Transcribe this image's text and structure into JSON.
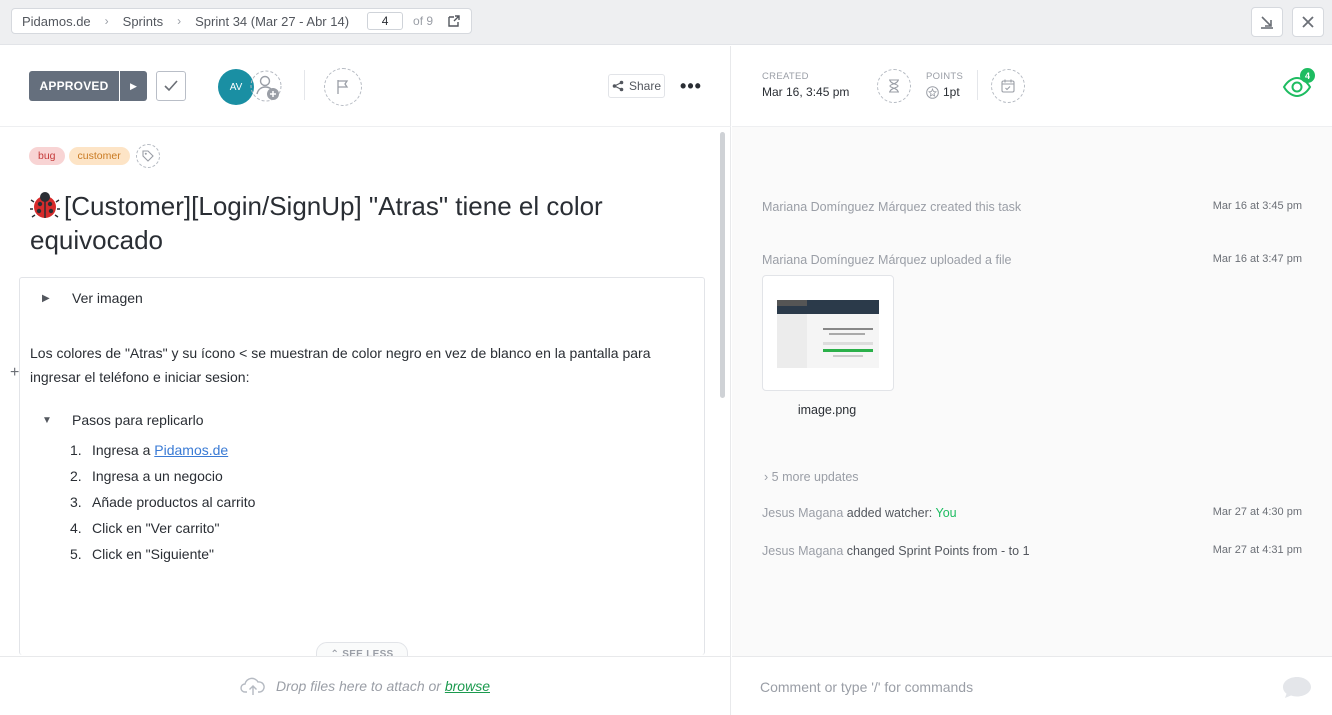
{
  "breadcrumb": {
    "items": [
      "Pidamos.de",
      "Sprints",
      "Sprint 34 (Mar 27 - Abr 14)"
    ],
    "page": "4",
    "of": "of 9"
  },
  "toolbar": {
    "status": "APPROVED",
    "avatar_initials": "AV",
    "share_label": "Share",
    "more": "•••"
  },
  "tags": [
    "bug",
    "customer"
  ],
  "task": {
    "title": "[Customer][Login/SignUp] \"Atras\" tiene el color equivocado",
    "toggle1": "Ver imagen",
    "description": "Los colores de \"Atras\" y su ícono < se muestran de color negro en vez de blanco en la pantalla para ingresar el teléfono e iniciar sesion:",
    "toggle2": "Pasos para replicarlo",
    "steps": [
      {
        "num": "1.",
        "prefix": "Ingresa a ",
        "link": "Pidamos.de"
      },
      {
        "num": "2.",
        "text": "Ingresa a un negocio"
      },
      {
        "num": "3.",
        "text": "Añade productos al carrito"
      },
      {
        "num": "4.",
        "text": "Click en \"Ver carrito\""
      },
      {
        "num": "5.",
        "text": "Click en \"Siguiente\""
      }
    ],
    "see_less": "SEE LESS"
  },
  "meta": {
    "created_label": "CREATED",
    "created_value": "Mar 16, 3:45 pm",
    "points_label": "POINTS",
    "points_value": "1pt",
    "watchers": "4"
  },
  "activity": [
    {
      "text": "Mariana Domínguez Márquez created this task",
      "time": "Mar 16 at 3:45 pm"
    },
    {
      "text": "Mariana Domínguez Márquez uploaded a file",
      "time": "Mar 16 at 3:47 pm"
    },
    {
      "actor": "Jesus Magana",
      "action": "added watcher: ",
      "target": "You",
      "time": "Mar 27 at 4:30 pm"
    },
    {
      "actor": "Jesus Magana",
      "action": "changed Sprint Points from - to 1",
      "time": "Mar 27 at 4:31 pm"
    }
  ],
  "file": {
    "name": "image.png"
  },
  "more_updates": "5 more updates",
  "attach": {
    "text": "Drop files here to attach or",
    "link": "browse"
  },
  "comment_placeholder": "Comment or type '/' for commands",
  "colors": {
    "status": "#656f7d",
    "avatar": "#1a8fa3",
    "accent_green": "#1ebc61",
    "tag_bug": "#f8d4d4",
    "tag_customer": "#fde4c6"
  }
}
